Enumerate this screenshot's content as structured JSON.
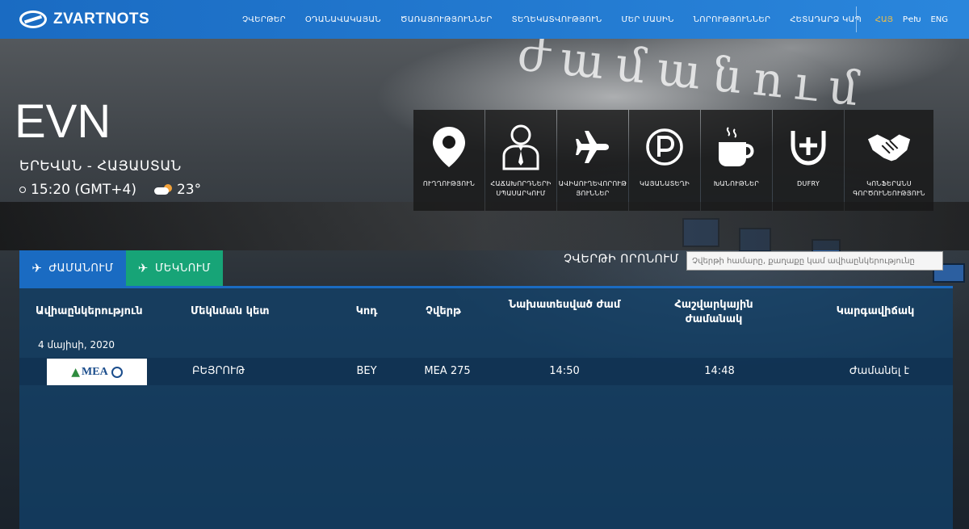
{
  "brand": {
    "name": "ZVARTNOTS"
  },
  "nav": {
    "items": [
      "ՉՎԵՐԹԵՐ",
      "ՕԴԱՆԱՎԱԿԱՅԱՆ",
      "ԾԱՌԱՅՈՒԹՅՈՒՆՆԵՐ",
      "ՏԵՂԵԿԱՏՎՈՒԹՅՈՒՆ",
      "ՄԵՐ ՄԱՍԻՆ",
      "ՆՈՐՈՒԹՅՈՒՆՆԵՐ",
      "ՀԵՏԱԴԱՐՁ ԿԱՊ"
    ],
    "languages": [
      {
        "label": "ՀԱՅ",
        "active": true
      },
      {
        "label": "РҽԽ"
      },
      {
        "label": "ENG"
      }
    ]
  },
  "airport": {
    "code": "EVN",
    "city": "ԵՐԵՎԱՆ - ՀԱՅԱՍՏԱՆ",
    "time": "15:20 (GMT+4)",
    "temperature": "23°"
  },
  "services": [
    {
      "label": "ՈՒՂՂՈՒԹՅՈՒՆ",
      "icon": "location-pin-icon"
    },
    {
      "label": "ՀԱՃԱԽՈՐԴՆԵՐԻ ՍՊԱՍԱՐԿՈՒՄ",
      "icon": "passenger-service-icon"
    },
    {
      "label": "ԱՎԻԱՈՒՂԵՎՈՐՈՒԹ ՅՈՒՆՆԵՐ",
      "icon": "airplane-icon"
    },
    {
      "label": "ԿԱՅԱՆԱՏԵՂԻ",
      "icon": "parking-icon"
    },
    {
      "label": "ԽԱՆՈՒԹՆԵՐ",
      "icon": "coffee-icon"
    },
    {
      "label": "DUFRY",
      "icon": "dufry-icon"
    },
    {
      "label": "ԿՈՆՖԵՐԱՆՍ ԳՈՐԾՈՒՆԵՈՒԹՅՈՒՆ",
      "icon": "handshake-icon"
    }
  ],
  "tabs": {
    "arrivals": "ԺԱՄԱՆՈՒՄ",
    "departures": "ՄԵԿՆՈՒՄ"
  },
  "search": {
    "label": "ՉՎԵՐԹԻ ՈՐՈՆՈՒՄ",
    "placeholder": "Չվերթի համարը, քաղաքը կամ ավիաընկերությունը"
  },
  "table": {
    "headers": {
      "airline": "Ավիաընկերություն",
      "origin": "Մեկնման կետ",
      "code": "Կոդ",
      "flight": "Չվերթ",
      "scheduled": "Նախատեսված ժամ",
      "estimated": "Հաշվարկային ժամանակ",
      "status": "Կարգավիճակ"
    },
    "date": "4 մայիսի, 2020",
    "rows": [
      {
        "airline_logo": "MEA",
        "origin": "ԲԵՅՐՈՒԹ",
        "code": "BEY",
        "flight": "MEA 275",
        "scheduled": "14:50",
        "estimated": "14:48",
        "status": "Ժամանել է"
      }
    ]
  }
}
